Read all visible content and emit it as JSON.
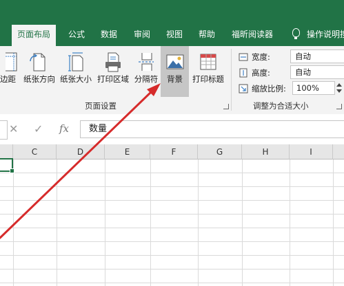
{
  "tabs": [
    {
      "label": "页面布局",
      "active": true
    },
    {
      "label": "公式",
      "active": false
    },
    {
      "label": "数据",
      "active": false
    },
    {
      "label": "审阅",
      "active": false
    },
    {
      "label": "视图",
      "active": false
    },
    {
      "label": "帮助",
      "active": false
    },
    {
      "label": "福昕阅读器",
      "active": false
    },
    {
      "label": "操作说明搜",
      "active": false
    }
  ],
  "ribbon": {
    "page_setup": {
      "margins": "边距",
      "orientation": "纸张方向",
      "size": "纸张大小",
      "print_area": "打印区域",
      "breaks": "分隔符",
      "background": "背景",
      "print_titles": "打印标题",
      "group_label": "页面设置"
    },
    "scale_to_fit": {
      "width_label": "宽度:",
      "width_value": "自动",
      "height_label": "高度:",
      "height_value": "自动",
      "scale_label": "缩放比例:",
      "scale_value": "100%",
      "group_label": "调整为合适大小"
    }
  },
  "formula_bar": {
    "cancel": "✕",
    "enter": "✓",
    "fx": "fx",
    "content": "数量"
  },
  "columns": [
    "C",
    "D",
    "E",
    "F",
    "G",
    "H",
    "I"
  ],
  "colors": {
    "excel_green": "#217346",
    "annotation_arrow": "#d62b2b",
    "selected_button": "#c6c6c6"
  }
}
